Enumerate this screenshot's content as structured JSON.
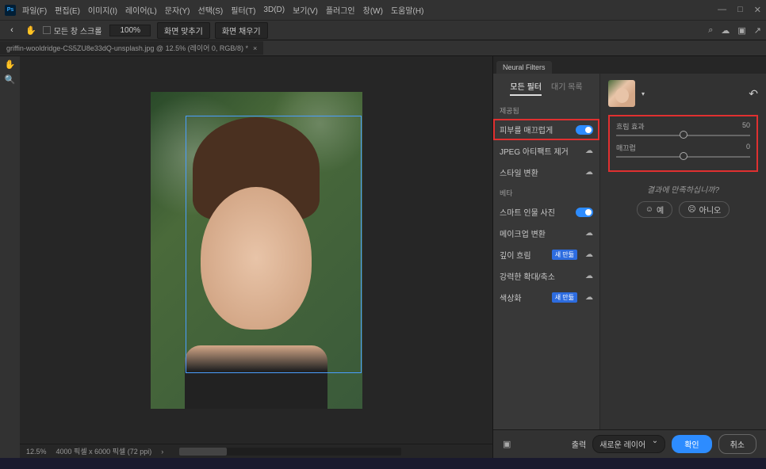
{
  "app": {
    "ps_badge": "Ps",
    "menus": [
      "파일(F)",
      "편집(E)",
      "이미지(I)",
      "레이어(L)",
      "문자(Y)",
      "선택(S)",
      "필터(T)",
      "3D(D)",
      "보기(V)",
      "플러그인",
      "창(W)",
      "도움말(H)"
    ]
  },
  "options": {
    "scroll_checkbox_label": "모든 창 스크롤",
    "zoom_value": "100%",
    "fit_screen": "화면 맞추기",
    "fill_screen": "화면 채우기"
  },
  "document": {
    "tab_title": "griffin-wooldridge-CS5ZU8e33dQ-unsplash.jpg @ 12.5% (레이어 0, RGB/8) *",
    "status_zoom": "12.5%",
    "status_dims": "4000 픽셀 x 6000 픽셀 (72 ppi)"
  },
  "panel": {
    "title": "Neural Filters",
    "tabs": {
      "all": "모든 필터",
      "wait": "대기 목록"
    },
    "section_provided": "제공됨",
    "section_beta": "베타",
    "filters": {
      "skin_smooth": "피부를 매끄럽게",
      "jpeg_artifact": "JPEG 아티팩트 제거",
      "style_transfer": "스타일 변환",
      "smart_portrait": "스마트 인물 사진",
      "makeup_transfer": "메이크업 변환",
      "depth_blur": "깊이 흐림",
      "super_zoom": "강력한 확대/축소",
      "colorize": "색상화"
    },
    "badge_new": "새 만듦"
  },
  "controls": {
    "slider1_label": "흐림 효과",
    "slider1_value": "50",
    "slider2_label": "매끄럽",
    "slider2_value": "0",
    "satisfy_text": "결과에 만족하십니까?",
    "yes": "예",
    "no": "아니오"
  },
  "bottom": {
    "output_label": "출력",
    "output_value": "새로운 레이어",
    "ok": "확인",
    "cancel": "취소"
  }
}
